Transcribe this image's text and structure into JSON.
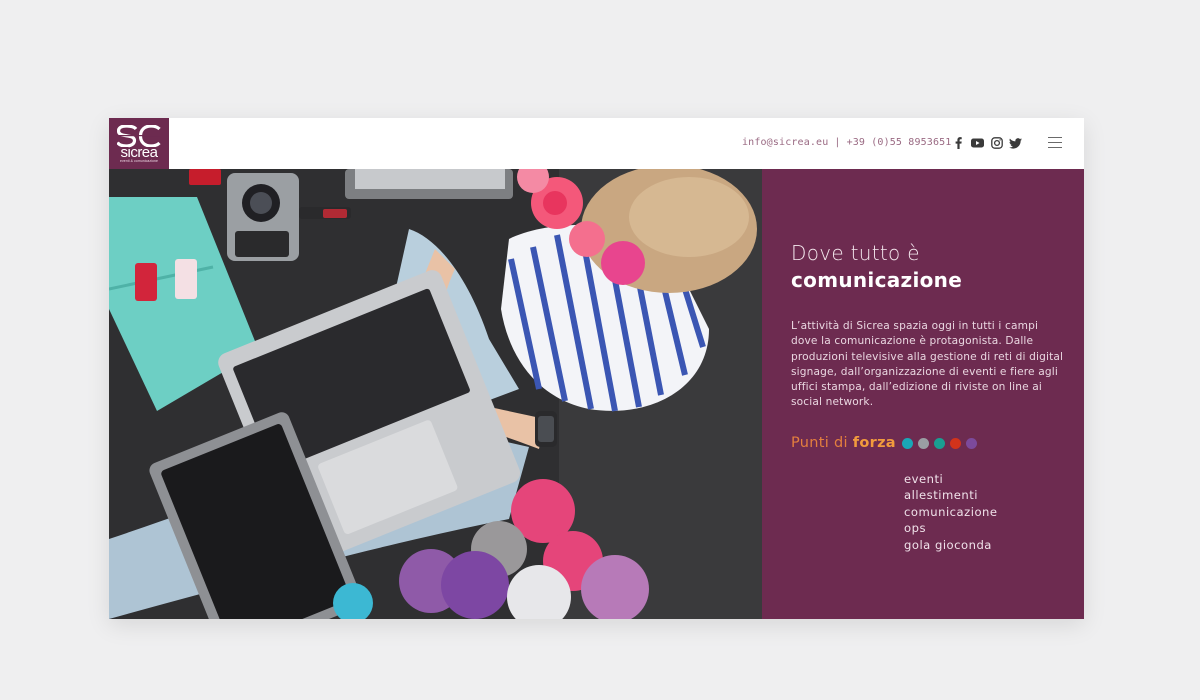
{
  "header": {
    "logo_text": "sicrea",
    "logo_tagline": "eventi & comunicazione",
    "email": "info@sicrea.eu",
    "separator": "|",
    "phone": "+39 (0)55 8953651",
    "social": [
      "facebook-icon",
      "youtube-icon",
      "instagram-icon",
      "twitter-icon"
    ],
    "menu_icon": "hamburger-menu-icon"
  },
  "hero": {
    "photo": "woman-with-laptop-flowers-yarn-balls"
  },
  "panel": {
    "headline_line1": "Dove tutto è",
    "headline_line2": "comunicazione",
    "paragraph": "L’attività di Sicrea spazia oggi in tutti i campi dove la comunicazione è protagonista. Dalle produzioni televisive alla gestione di reti di digital signage, dall’organizzazione di eventi e fiere agli uffici stampa, dall’edizione di riviste on line ai social network.",
    "forza_prefix": "Punti di",
    "forza_bold": "forza",
    "dot_colors": [
      "#1aa7b7",
      "#9a9ea3",
      "#1a9e92",
      "#d2331b",
      "#7c4a9c"
    ],
    "items": [
      "eventi",
      "allestimenti",
      "comunicazione",
      "ops",
      "gola gioconda"
    ]
  },
  "colors": {
    "brand_plum": "#6d2b50",
    "accent_orange": "#e47f3e",
    "page_bg": "#efeff0"
  }
}
